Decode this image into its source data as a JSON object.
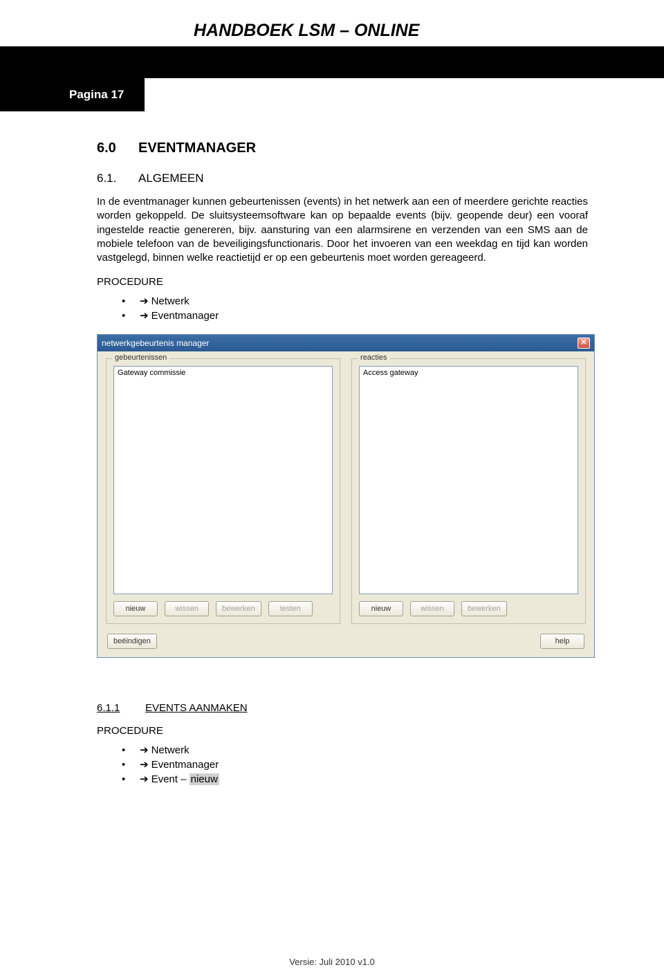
{
  "doc": {
    "title": "HANDBOEK LSM – ONLINE",
    "page_label": "Pagina 17",
    "footer": "Versie: Juli 2010 v1.0"
  },
  "sections": {
    "s1": {
      "num": "6.0",
      "title": "EVENTMANAGER"
    },
    "s2": {
      "num": "6.1.",
      "title": "ALGEMEEN"
    },
    "body": "In de eventmanager kunnen gebeurtenissen (events) in het netwerk aan een of meerdere gerichte reacties worden gekoppeld. De sluitsysteemsoftware kan op bepaalde events (bijv. geopende deur) een vooraf ingestelde reactie genereren, bijv. aansturing van een alarmsirene en verzenden van een SMS aan de mobiele telefoon van de beveiligingsfunctionaris. Door het invoeren van een weekdag en tijd kan worden vastgelegd, binnen welke reactietijd er op een gebeurtenis moet worden gereageerd.",
    "proc_label": "PROCEDURE",
    "proc1": {
      "i1": "Netwerk",
      "i2": "Eventmanager"
    },
    "s3": {
      "num": "6.1.1",
      "title": "EVENTS AANMAKEN"
    },
    "proc2": {
      "i1": "Netwerk",
      "i2": "Eventmanager",
      "i3_prefix": "Event – ",
      "i3_hl": "nieuw"
    }
  },
  "dialog": {
    "title": "netwerkgebeurtenis manager",
    "left": {
      "legend": "gebeurtenissen",
      "item": "Gateway commissie",
      "btn_new": "nieuw",
      "btn_del": "wissen",
      "btn_edit": "bewerken",
      "btn_test": "testen"
    },
    "right": {
      "legend": "reacties",
      "item": "Access gateway",
      "btn_new": "nieuw",
      "btn_del": "wissen",
      "btn_edit": "bewerken"
    },
    "btn_close": "beëindigen",
    "btn_help": "help"
  },
  "arrow": "➔"
}
